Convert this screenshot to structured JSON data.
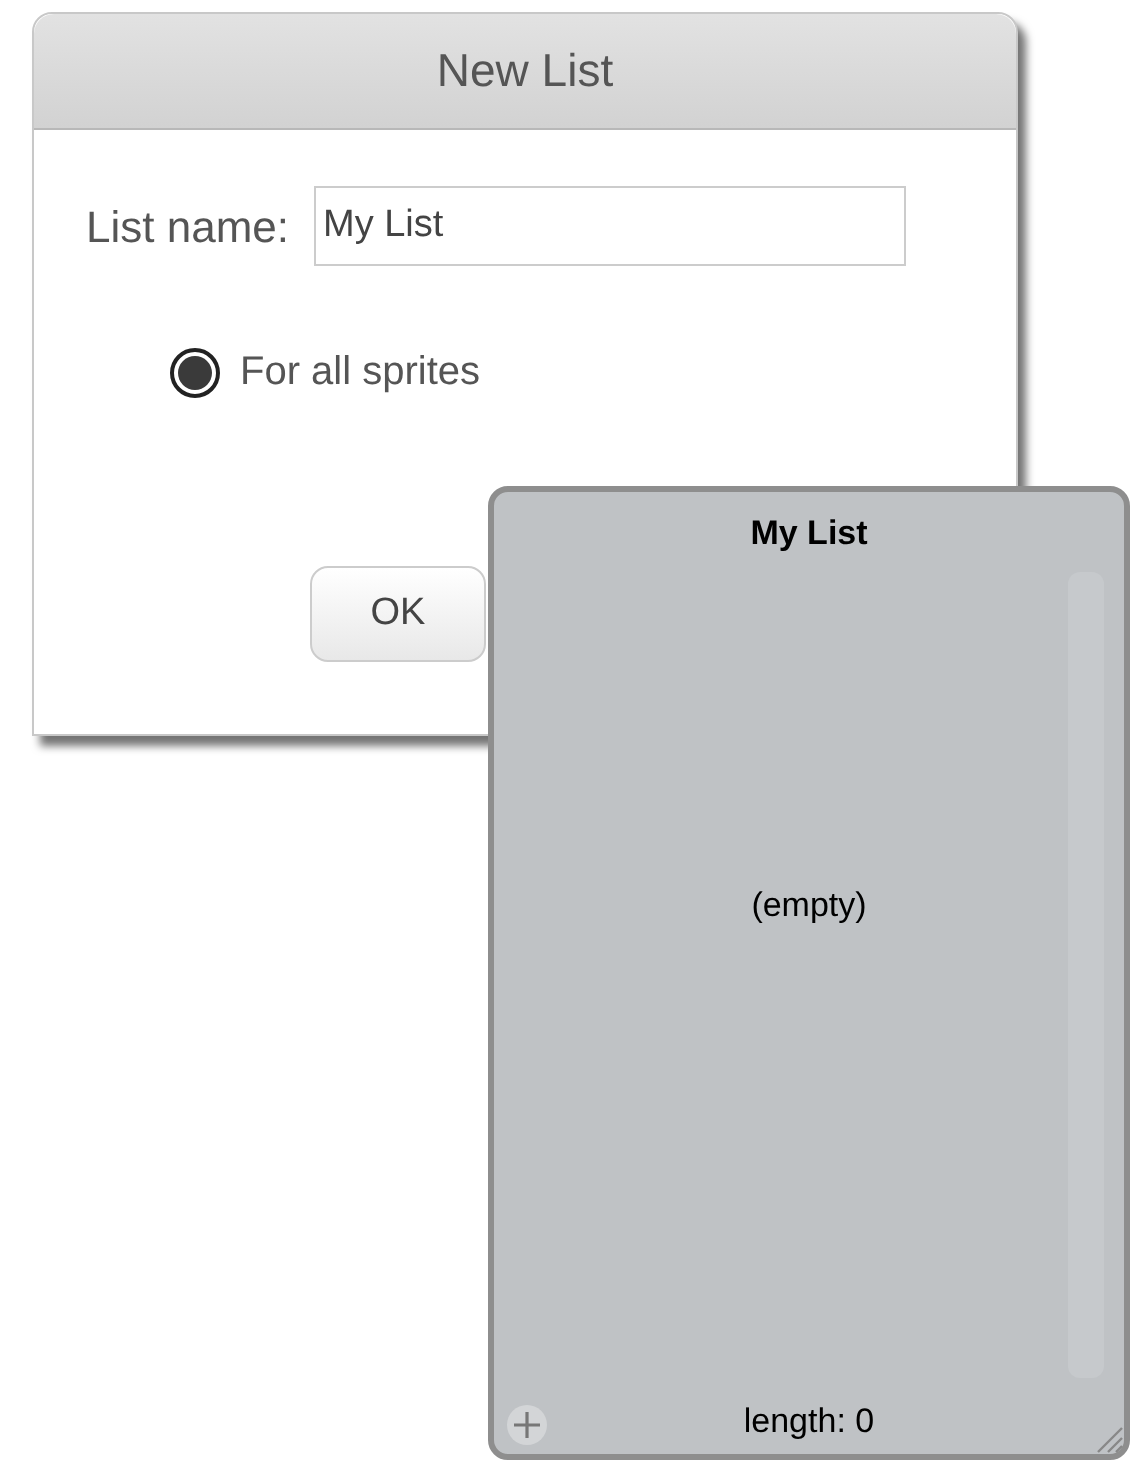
{
  "dialog": {
    "title": "New List",
    "name_label": "List name:",
    "name_value": "My List",
    "options": [
      {
        "label": "For all sprites",
        "selected": true
      }
    ],
    "buttons": [
      "OK"
    ]
  },
  "list_monitor": {
    "title": "My List",
    "empty_text": "(empty)",
    "length_text": "length: 0"
  }
}
